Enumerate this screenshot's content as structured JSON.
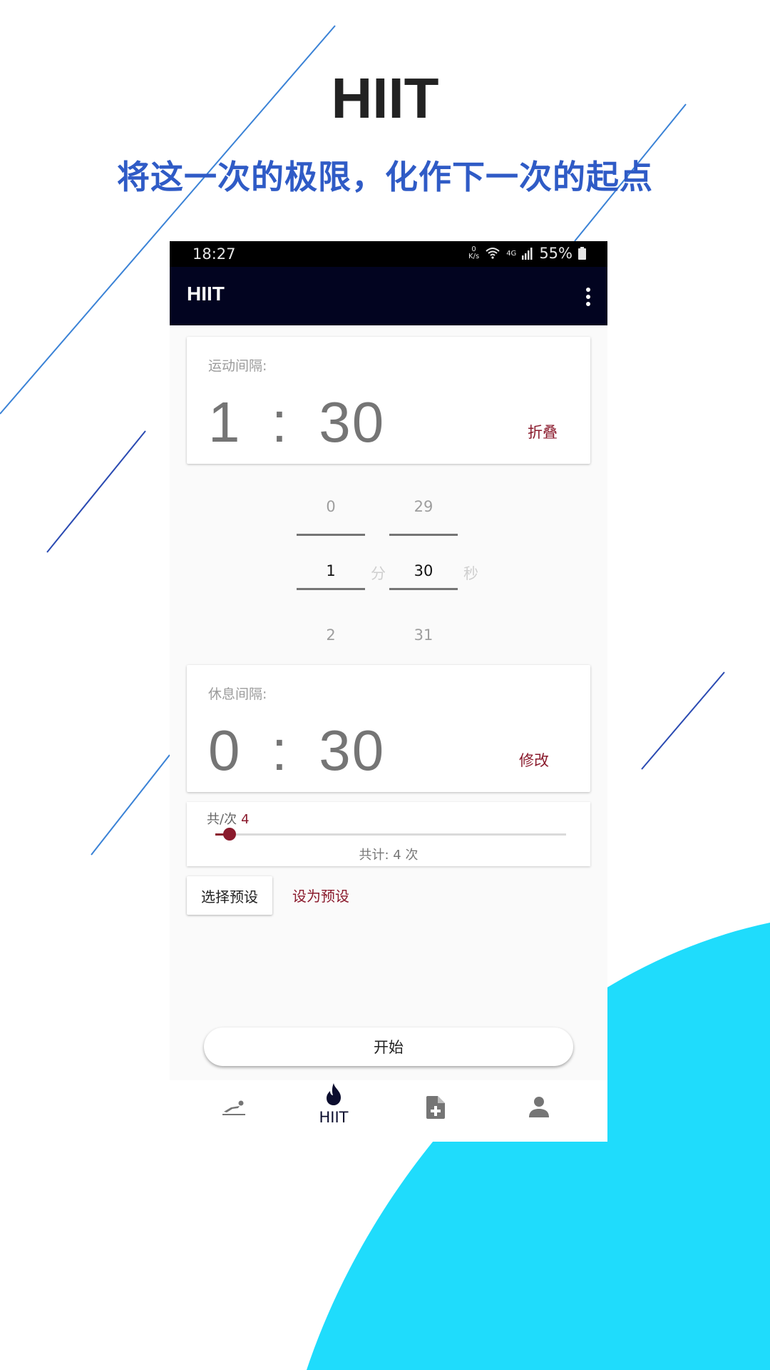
{
  "hero": {
    "title": "HIIT",
    "subtitle": "将这一次的极限，化作下一次的起点"
  },
  "status_bar": {
    "time": "18:27",
    "net_speed_value": "0",
    "net_speed_unit": "K/s",
    "network": "4G",
    "battery": "55%"
  },
  "app_bar": {
    "title": "HIIT"
  },
  "exercise_card": {
    "label": "运动间隔:",
    "minutes": "1",
    "separator": ":",
    "seconds": "30",
    "action": "折叠"
  },
  "picker": {
    "minutes": {
      "prev": "0",
      "selected": "1",
      "next": "2",
      "unit": "分"
    },
    "seconds": {
      "prev": "29",
      "selected": "30",
      "next": "31",
      "unit": "秒"
    }
  },
  "rest_card": {
    "label": "休息间隔:",
    "minutes": "0",
    "separator": ":",
    "seconds": "30",
    "action": "修改"
  },
  "rounds": {
    "label": "共/次",
    "count": "4",
    "total": "共计: 4 次",
    "slider_fraction": 0.04
  },
  "buttons": {
    "choose_preset": "选择预设",
    "save_preset": "设为预设",
    "start": "开始"
  },
  "bottom_nav": {
    "items": [
      {
        "icon": "workout-icon",
        "label": ""
      },
      {
        "icon": "fire-icon",
        "label": "HIIT"
      },
      {
        "icon": "add-document-icon",
        "label": ""
      },
      {
        "icon": "person-icon",
        "label": ""
      }
    ]
  },
  "colors": {
    "accent": "#8a1a2c",
    "app_bar": "#020420",
    "hero_subtitle": "#2f5bc6",
    "cyan_shape": "#1fdcfc"
  }
}
